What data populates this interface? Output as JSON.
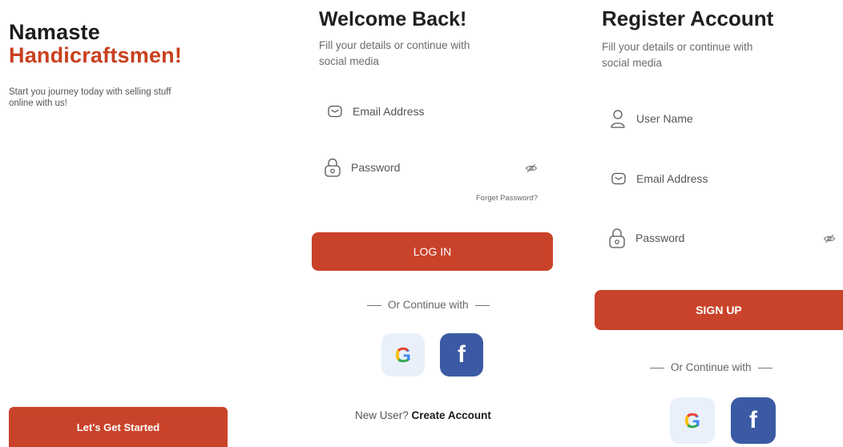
{
  "onboarding": {
    "greeting_line1": "Namaste",
    "greeting_line2": "Handicraftsmen!",
    "subtitle": "Start you journey today with selling stuff online with us!",
    "cta_label": "Let's Get Started"
  },
  "login": {
    "title": "Welcome Back!",
    "subtitle": "Fill your details or continue with social media",
    "email_placeholder": "Email Address",
    "password_placeholder": "Password",
    "forgot_label": "Forget Password?",
    "submit_label": "LOG IN",
    "divider_text": "Or Continue with",
    "new_user_text": "New User?",
    "create_account_label": "Create Account"
  },
  "register": {
    "title": "Register Account",
    "subtitle": "Fill your details or continue with social media",
    "username_placeholder": "User Name",
    "email_placeholder": "Email Address",
    "password_placeholder": "Password",
    "submit_label": "SIGN UP",
    "divider_text": "Or Continue with"
  },
  "social": {
    "google_letter": "G",
    "facebook_letter": "f"
  },
  "colors": {
    "accent": "#c9432a",
    "facebook": "#3b5aa3",
    "google_tile": "#e9f0fa"
  },
  "icons": [
    "mail-icon",
    "lock-icon",
    "eye-off-icon",
    "user-icon",
    "google-icon",
    "facebook-icon"
  ]
}
